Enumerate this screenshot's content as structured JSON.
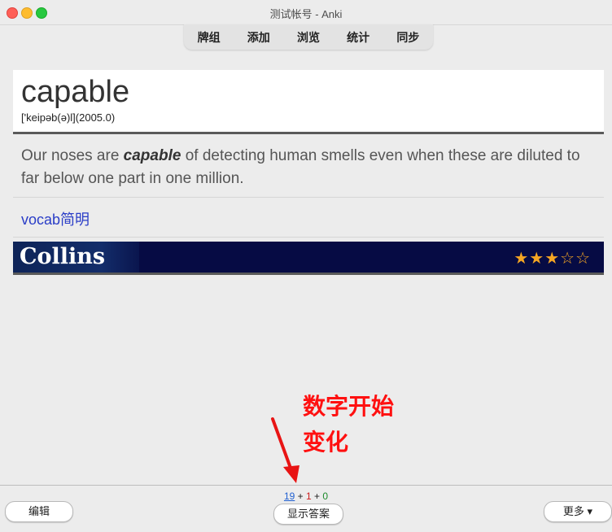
{
  "window": {
    "title": "测试帐号 - Anki"
  },
  "toolbar": {
    "items": [
      "牌组",
      "添加",
      "浏览",
      "统计",
      "同步"
    ]
  },
  "card": {
    "word": "capable",
    "phonetic": "['keipəb(ə)l](2005.0)",
    "example_before": "Our noses are ",
    "example_bold": "capable",
    "example_after": " of detecting human smells even when these are diluted to far below one part in one million.",
    "vocab_link": "vocab简明",
    "collins_logo": "Collins",
    "stars": "★★★☆☆",
    "star_rating": 3,
    "star_max": 5
  },
  "annotation": {
    "line1": "数字开始",
    "line2": "变化"
  },
  "counts": {
    "new": "19",
    "plus1": " + ",
    "learning": "1",
    "plus2": " + ",
    "review": "0"
  },
  "buttons": {
    "edit": "编辑",
    "show_answer": "显示答案",
    "more": "更多 ▾"
  },
  "colors": {
    "collins_bg": "#060b44",
    "star": "#f5a623",
    "annotation": "#ff1010",
    "new": "#1f5fd1",
    "learning": "#cc1d1d",
    "review": "#1c8a2b"
  }
}
